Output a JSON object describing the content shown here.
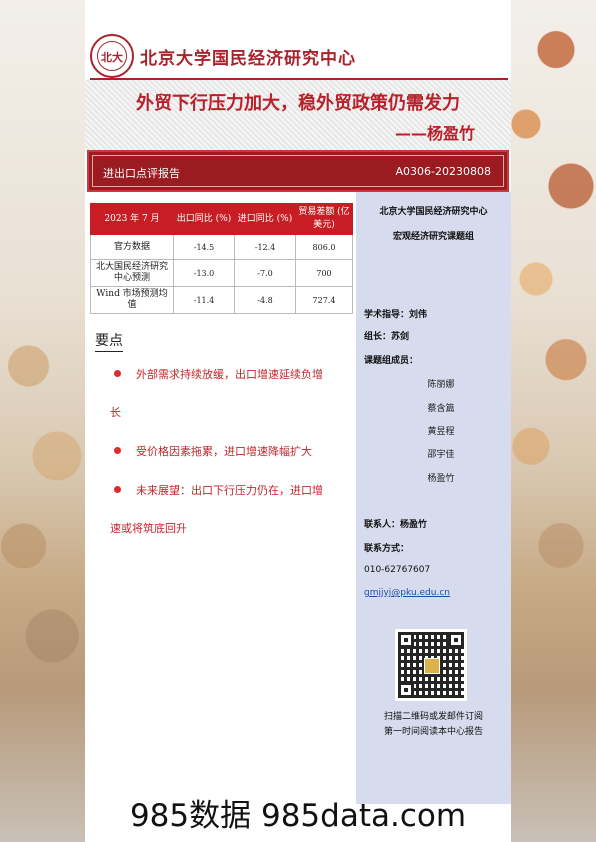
{
  "header": {
    "org_name": "北京大学国民经济研究中心",
    "main_title": "外贸下行压力加大，稳外贸政策仍需发力",
    "author": "——杨盈竹"
  },
  "band": {
    "left": "进出口点评报告",
    "right": "A0306-20230808"
  },
  "table": {
    "headers": [
      "2023 年 7 月",
      "出口同比 (%)",
      "进口同比 (%)",
      "贸易差额 (亿美元)"
    ],
    "rows": [
      [
        "官方数据",
        "-14.5",
        "-12.4",
        "806.0"
      ],
      [
        "北大国民经济研究中心预测",
        "-13.0",
        "-7.0",
        "700"
      ],
      [
        "Wind 市场预测均值",
        "-11.4",
        "-4.8",
        "727.4"
      ]
    ]
  },
  "key_points": {
    "title": "要点",
    "items": [
      [
        "外部需求持续放缓，出口增速延续负增",
        "长"
      ],
      [
        "受价格因素拖累，进口增速降幅扩大"
      ],
      [
        "未来展望：出口下行压力仍在，进口增",
        "速或将筑底回升"
      ]
    ]
  },
  "sidebar": {
    "center_name": "北京大学国民经济研究中心",
    "group": "宏观经济研究课题组",
    "advisor": "学术指导：刘伟",
    "leader": "组长：苏剑",
    "members_label": "课题组成员：",
    "members": [
      "陈丽娜",
      "蔡含篇",
      "黄昱程",
      "邵宇佳",
      "杨盈竹"
    ],
    "contact_person": "联系人：杨盈竹",
    "contact_label": "联系方式：",
    "phone": "010-62767607",
    "email": "gmjjyj@pku.edu.cn",
    "qr_caption_1": "扫描二维码或发邮件订阅",
    "qr_caption_2": "第一时间阅读本中心报告"
  },
  "watermark": "985数据 985data.com"
}
